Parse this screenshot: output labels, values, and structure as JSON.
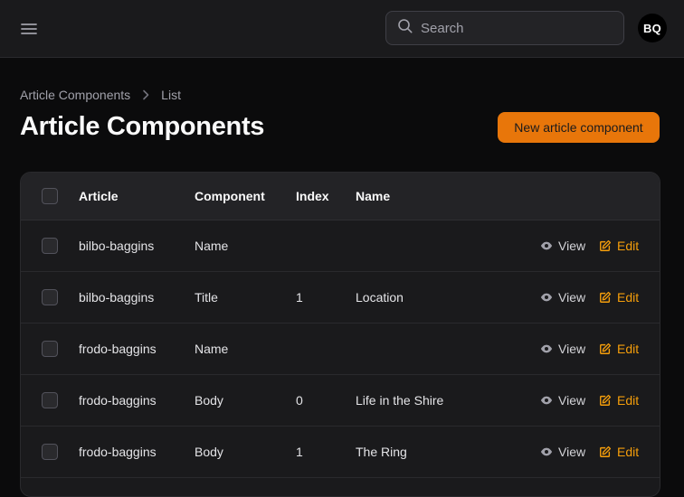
{
  "header": {
    "search_placeholder": "Search",
    "avatar_initials": "BQ"
  },
  "breadcrumb": {
    "parent": "Article Components",
    "current": "List"
  },
  "page": {
    "title": "Article Components",
    "new_button": "New article component"
  },
  "table": {
    "columns": {
      "article": "Article",
      "component": "Component",
      "index": "Index",
      "name": "Name"
    },
    "view_label": "View",
    "edit_label": "Edit",
    "rows": [
      {
        "article": "bilbo-baggins",
        "component": "Name",
        "index": "",
        "name": ""
      },
      {
        "article": "bilbo-baggins",
        "component": "Title",
        "index": "1",
        "name": "Location"
      },
      {
        "article": "frodo-baggins",
        "component": "Name",
        "index": "",
        "name": ""
      },
      {
        "article": "frodo-baggins",
        "component": "Body",
        "index": "0",
        "name": "Life in the Shire"
      },
      {
        "article": "frodo-baggins",
        "component": "Body",
        "index": "1",
        "name": "The Ring"
      }
    ]
  },
  "colors": {
    "accent": "#e8760a",
    "edit": "#f59e0b",
    "background": "#0b0b0c",
    "surface": "#1a1a1c"
  }
}
